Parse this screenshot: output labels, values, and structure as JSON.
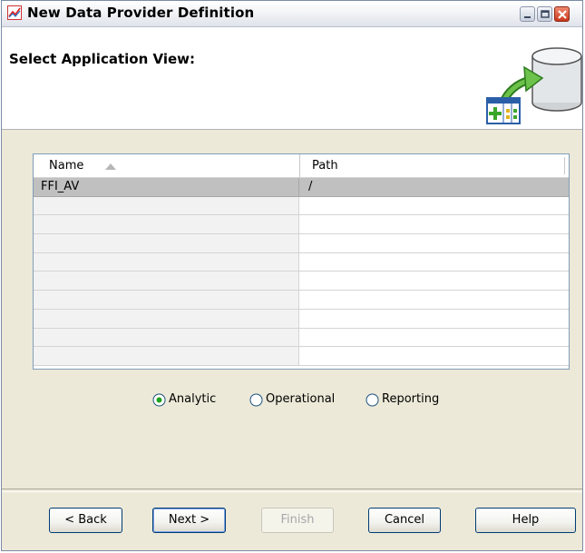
{
  "window": {
    "title": "New Data Provider Definition"
  },
  "header": {
    "title": "Select Application View:"
  },
  "list": {
    "columns": [
      {
        "label": "Name",
        "sorted": "ascending"
      },
      {
        "label": "Path"
      }
    ],
    "rows": [
      {
        "name": "FFI_AV",
        "path": "/",
        "selected": true
      }
    ],
    "empty_row_count": 9
  },
  "view_type": {
    "options": [
      "Analytic",
      "Operational",
      "Reporting"
    ],
    "selected": "Analytic"
  },
  "buttons": {
    "back": "< Back",
    "next": "Next >",
    "finish": "Finish",
    "cancel": "Cancel",
    "help": "Help"
  },
  "colors": {
    "close_button": "#c9361a",
    "selection": "#c0c0c0",
    "dialog_face": "#ece9d8"
  }
}
